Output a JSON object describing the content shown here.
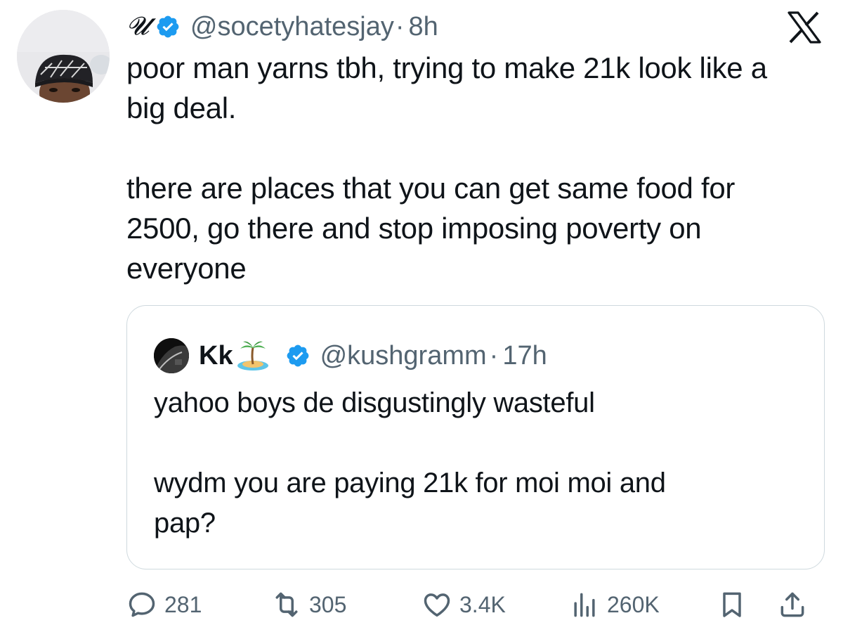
{
  "tweet": {
    "display_name": "𝓤",
    "handle": "@socetyhatesjay",
    "separator": "·",
    "time": "8h",
    "text_lines": [
      "poor man yarns tbh, trying to make 21k look like a",
      "big deal.",
      "",
      "there are places that you can get same food for",
      "2500, go there and stop imposing poverty on",
      "everyone"
    ]
  },
  "quote": {
    "name": "Kk",
    "name_emoji": "🏝",
    "handle": "@kushgramm",
    "separator": "·",
    "time": "17h",
    "text_lines": [
      "yahoo boys de disgustingly wasteful",
      "",
      "wydm you are paying 21k for moi moi and",
      "pap?"
    ]
  },
  "actions": {
    "replies": "281",
    "retweets": "305",
    "likes": "3.4K",
    "views": "260K"
  },
  "icons": {
    "verified": "verified-badge-icon",
    "x_logo": "x-logo-icon",
    "reply": "reply-bubble-icon",
    "retweet": "retweet-arrows-icon",
    "like": "heart-icon",
    "views": "bar-chart-icon",
    "bookmark": "bookmark-icon",
    "share": "share-upload-icon"
  },
  "colors": {
    "text_primary": "#0f1419",
    "text_secondary": "#536471",
    "verified_blue": "#1d9bf0",
    "border": "#cfd9de"
  }
}
